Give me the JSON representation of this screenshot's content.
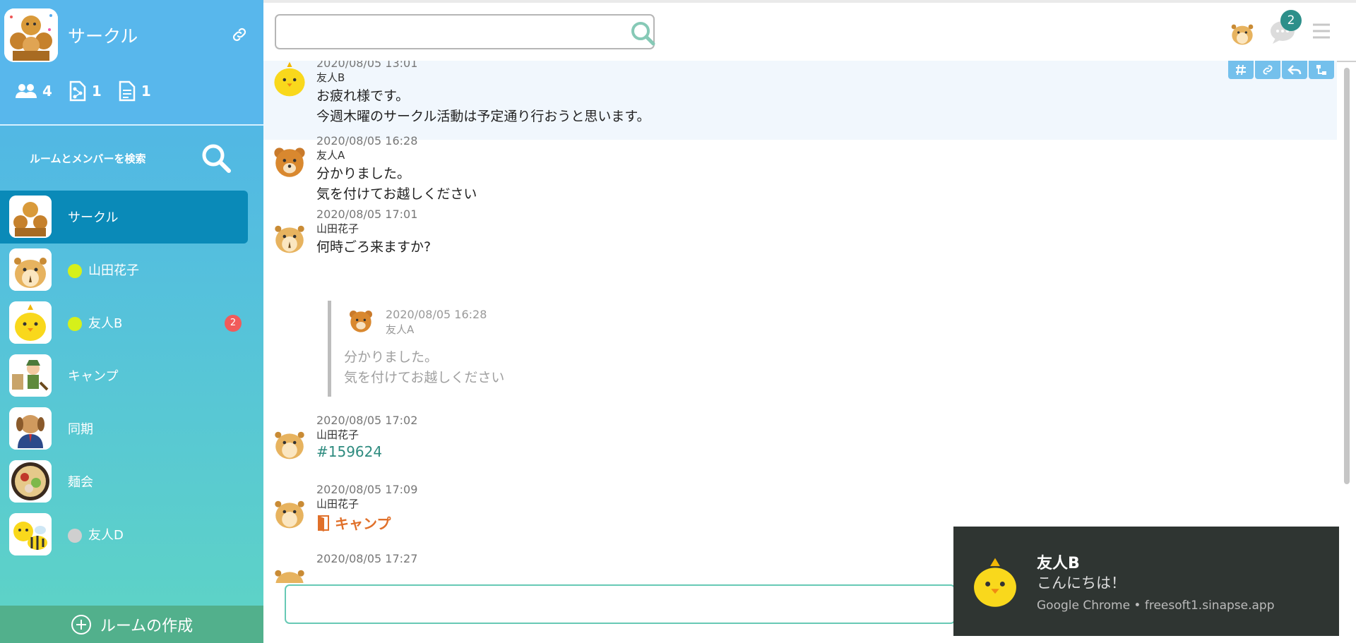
{
  "sidebar": {
    "title": "サークル",
    "stats": {
      "members": "4",
      "files": "1",
      "docs": "1"
    },
    "search_label": "ルームとメンバーを検索",
    "rooms": [
      {
        "label": "サークル",
        "active": true
      },
      {
        "label": "山田花子",
        "status": "online"
      },
      {
        "label": "友人B",
        "status": "online",
        "badge": "2"
      },
      {
        "label": "キャンプ"
      },
      {
        "label": "同期"
      },
      {
        "label": "麺会"
      },
      {
        "label": "友人D",
        "status": "offline"
      }
    ],
    "create_label": "ルームの作成"
  },
  "header": {
    "search_placeholder": "",
    "notification_count": "2"
  },
  "messages": [
    {
      "time": "2020/08/05 13:01",
      "author": "友人B",
      "lines": [
        "お疲れ様です。",
        "今週木曜のサークル活動は予定通り行おうと思います。"
      ]
    },
    {
      "time": "2020/08/05 16:28",
      "author": "友人A",
      "lines": [
        "分かりました。",
        "気を付けてお越しください"
      ]
    },
    {
      "time": "2020/08/05 17:01",
      "author": "山田花子",
      "lines": [
        "何時ごろ来ますか?"
      ],
      "quote": {
        "time": "2020/08/05 16:28",
        "author": "友人A",
        "lines": [
          "分かりました。",
          "気を付けてお越しください"
        ]
      }
    },
    {
      "time": "2020/08/05 17:02",
      "author": "山田花子",
      "tag": "#159624"
    },
    {
      "time": "2020/08/05 17:09",
      "author": "山田花子",
      "room_link": "キャンプ"
    },
    {
      "time": "2020/08/05 17:27"
    }
  ],
  "toast": {
    "sender": "友人B",
    "message": "こんにちは！",
    "source": "Google Chrome • freesoft1.sinapse.app"
  },
  "colors": {
    "accent": "#0a8ab8",
    "online": "#d6f01a",
    "offline": "#cfcfcf",
    "badge": "#f15b5b",
    "tag": "#2e8b7f",
    "room_link": "#e0702a"
  }
}
